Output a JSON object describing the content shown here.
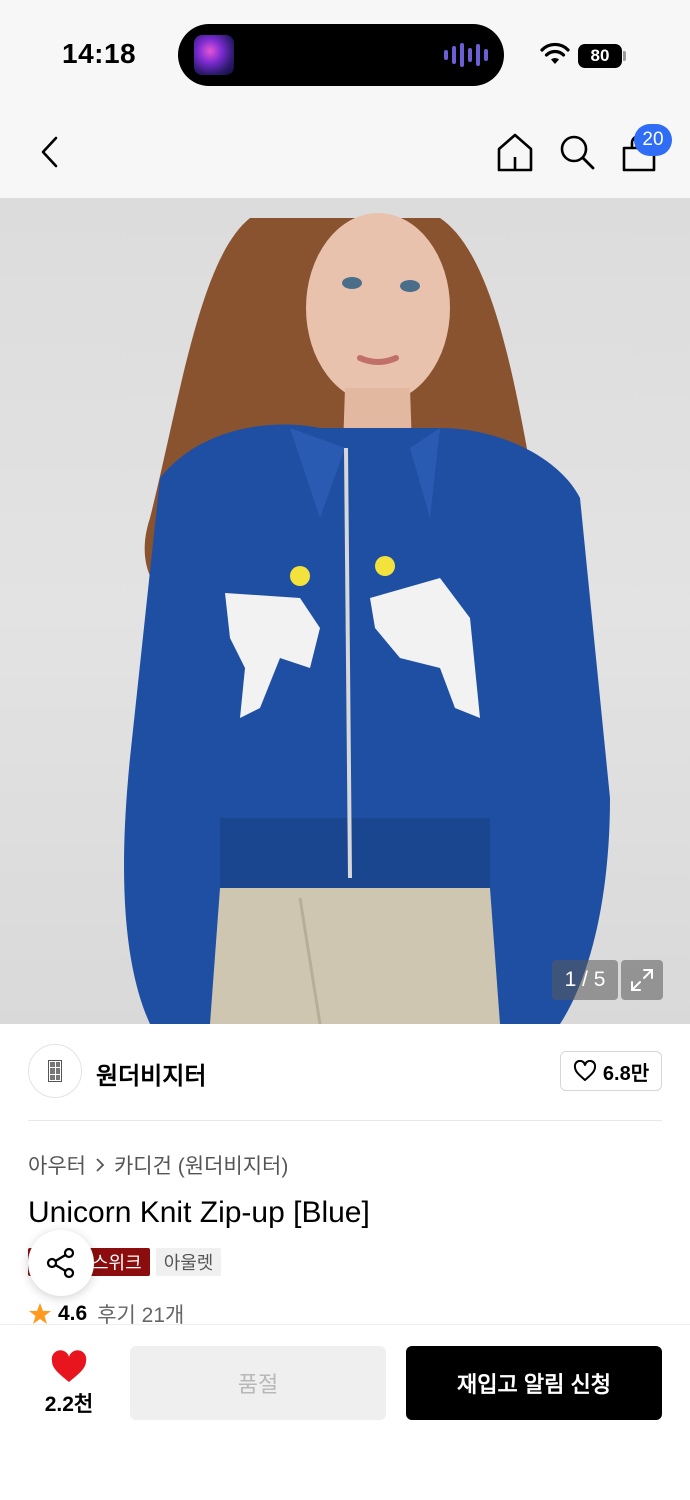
{
  "status_bar": {
    "time": "14:18",
    "battery": "80"
  },
  "header": {
    "cart_count": "20"
  },
  "gallery": {
    "counter": "1 / 5"
  },
  "brand": {
    "name": "원더비지터",
    "like_count": "6.8만"
  },
  "product": {
    "breadcrumb": [
      "아우터",
      "카디건 (원더비지터)"
    ],
    "title": "Unicorn Knit Zip-up [Blue]",
    "badge_sale": "스위크",
    "badge_outlet": "아울렛",
    "rating": "4.6",
    "review_label": "후기 21개"
  },
  "bottom": {
    "wish_count": "2.2천",
    "soldout_label": "품절",
    "restock_label": "재입고 알림 신청"
  },
  "colors": {
    "accent_blue": "#2f6df6",
    "sale_red": "#8b0d0d",
    "heart_red": "#e8141e",
    "star_orange": "#ff9a1f"
  }
}
